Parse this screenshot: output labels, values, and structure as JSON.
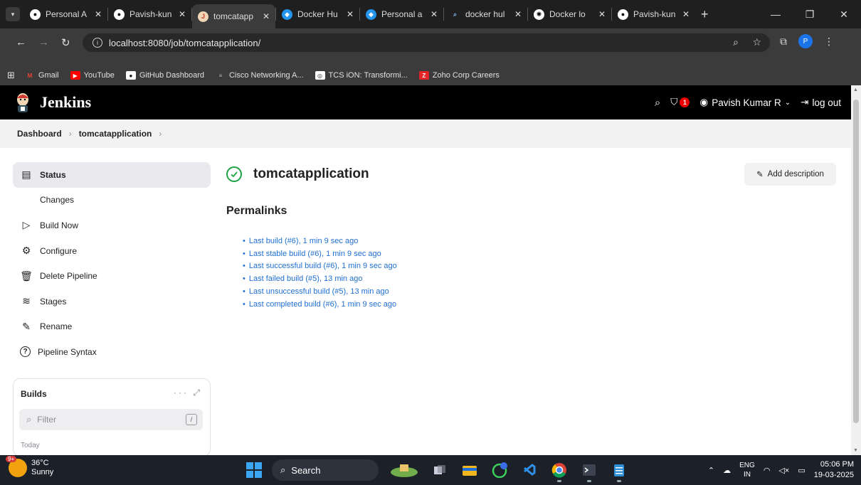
{
  "browser": {
    "tabs": [
      {
        "title": "Personal A",
        "icon": "github-icon",
        "active": false
      },
      {
        "title": "Pavish-kun",
        "icon": "github-icon",
        "active": false
      },
      {
        "title": "tomcatapp",
        "icon": "jenkins-icon",
        "active": true
      },
      {
        "title": "Docker Hu",
        "icon": "docker-icon",
        "active": false
      },
      {
        "title": "Personal a",
        "icon": "docker-icon",
        "active": false
      },
      {
        "title": "docker hul",
        "icon": "search-icon",
        "active": false
      },
      {
        "title": "Docker lo",
        "icon": "openai-icon",
        "active": false
      },
      {
        "title": "Pavish-kun",
        "icon": "github-icon",
        "active": false
      }
    ],
    "url": "localhost:8080/job/tomcatapplication/",
    "profile_initial": "P",
    "bookmarks": [
      {
        "label": "Gmail",
        "icon": "gmail-icon"
      },
      {
        "label": "YouTube",
        "icon": "youtube-icon"
      },
      {
        "label": "GitHub Dashboard",
        "icon": "github-icon"
      },
      {
        "label": "Cisco Networking A...",
        "icon": "cisco-icon"
      },
      {
        "label": "TCS iON: Transformi...",
        "icon": "tcs-icon"
      },
      {
        "label": "Zoho Corp Careers",
        "icon": "zoho-icon"
      }
    ]
  },
  "jenkins": {
    "brand": "Jenkins",
    "security_count": "1",
    "user_name": "Pavish Kumar R",
    "logout_label": "log out",
    "breadcrumb": [
      "Dashboard",
      "tomcatapplication"
    ],
    "sidebar": [
      {
        "label": "Status",
        "icon": "status-icon",
        "active": true
      },
      {
        "label": "Changes",
        "icon": "code-icon",
        "active": false
      },
      {
        "label": "Build Now",
        "icon": "play-icon",
        "active": false
      },
      {
        "label": "Configure",
        "icon": "gear-icon",
        "active": false
      },
      {
        "label": "Delete Pipeline",
        "icon": "trash-icon",
        "active": false
      },
      {
        "label": "Stages",
        "icon": "stages-icon",
        "active": false
      },
      {
        "label": "Rename",
        "icon": "pencil-icon",
        "active": false
      },
      {
        "label": "Pipeline Syntax",
        "icon": "help-icon",
        "active": false
      }
    ],
    "builds": {
      "title": "Builds",
      "filter_placeholder": "Filter",
      "shortcut": "/",
      "group_label": "Today"
    },
    "job_name": "tomcatapplication",
    "add_description_label": "Add description",
    "permalinks_title": "Permalinks",
    "permalinks": [
      "Last build (#6), 1 min 9 sec ago",
      "Last stable build (#6), 1 min 9 sec ago",
      "Last successful build (#6), 1 min 9 sec ago",
      "Last failed build (#5), 13 min ago",
      "Last unsuccessful build (#5), 13 min ago",
      "Last completed build (#6), 1 min 9 sec ago"
    ]
  },
  "taskbar": {
    "weather_badge": "9+",
    "temperature": "36°C",
    "condition": "Sunny",
    "search_label": "Search",
    "lang_top": "ENG",
    "lang_bottom": "IN",
    "time": "05:06 PM",
    "date": "19-03-2025"
  },
  "colors": {
    "link": "#1f6fd1",
    "success": "#1ea446",
    "header_bg": "#000000"
  }
}
